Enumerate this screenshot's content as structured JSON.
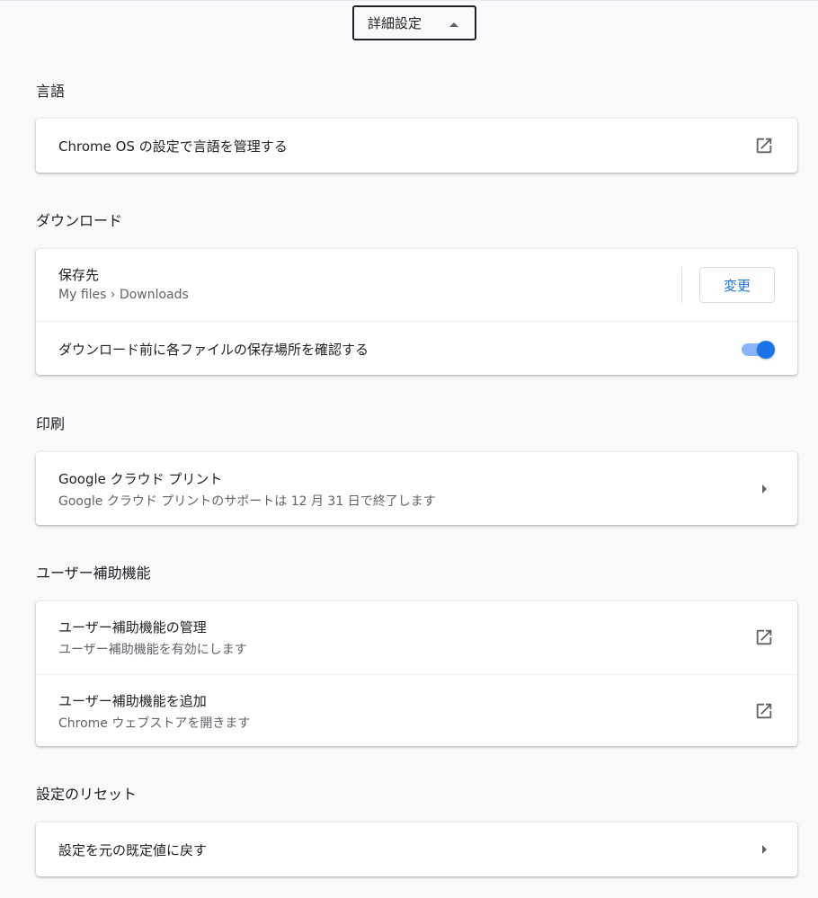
{
  "advanced": {
    "label": "詳細設定"
  },
  "sections": {
    "language": {
      "title": "言語",
      "manage_label": "Chrome OS の設定で言語を管理する"
    },
    "downloads": {
      "title": "ダウンロード",
      "location_label": "保存先",
      "location_path": "My files › Downloads",
      "change_button": "変更",
      "ask_where_label": "ダウンロード前に各ファイルの保存場所を確認する",
      "ask_where_enabled": true
    },
    "printing": {
      "title": "印刷",
      "cloud_print_label": "Google クラウド プリント",
      "cloud_print_sub": "Google クラウド プリントのサポートは 12 月 31 日で終了します"
    },
    "accessibility": {
      "title": "ユーザー補助機能",
      "manage_label": "ユーザー補助機能の管理",
      "manage_sub": "ユーザー補助機能を有効にします",
      "add_label": "ユーザー補助機能を追加",
      "add_sub": "Chrome ウェブストアを開きます"
    },
    "reset": {
      "title": "設定のリセット",
      "restore_label": "設定を元の既定値に戻す"
    }
  },
  "icons": {
    "external": "open-in-new-icon",
    "arrow": "arrow-right-icon",
    "caret": "caret-up-icon"
  },
  "colors": {
    "accent": "#1a73e8",
    "toggle_track": "#8ab4f8",
    "background": "#f8f9fa"
  }
}
